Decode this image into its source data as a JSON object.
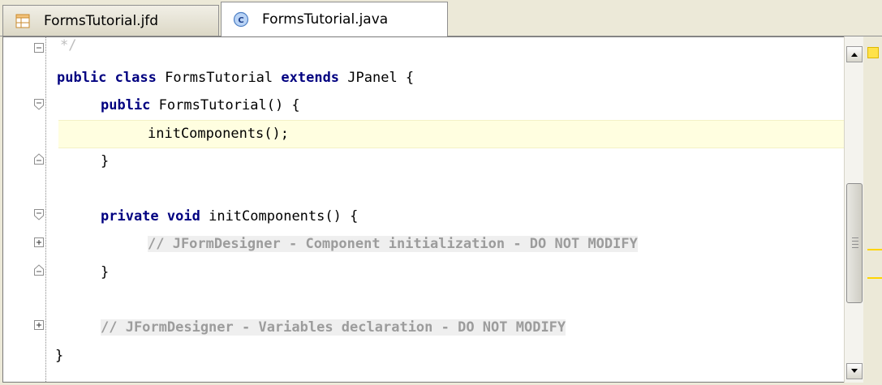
{
  "tabs": [
    {
      "label": "FormsTutorial.jfd",
      "icon": "form-file-icon",
      "active": false
    },
    {
      "label": "FormsTutorial.java",
      "icon": "java-class-icon",
      "active": true
    }
  ],
  "editor": {
    "lines": [
      "*/",
      "public class FormsTutorial extends JPanel {",
      "public FormsTutorial() {",
      "initComponents();",
      "}",
      "",
      "private void initComponents() {",
      "// JFormDesigner - Component initialization - DO NOT MODIFY",
      "}",
      "",
      "// JFormDesigner - Variables declaration - DO NOT MODIFY",
      "}"
    ]
  },
  "colors": {
    "keyword": "#000080",
    "folded_comment": "#9c9c9c",
    "current_line": "#fffee0",
    "error_stripe_mark": "#ffd400"
  }
}
